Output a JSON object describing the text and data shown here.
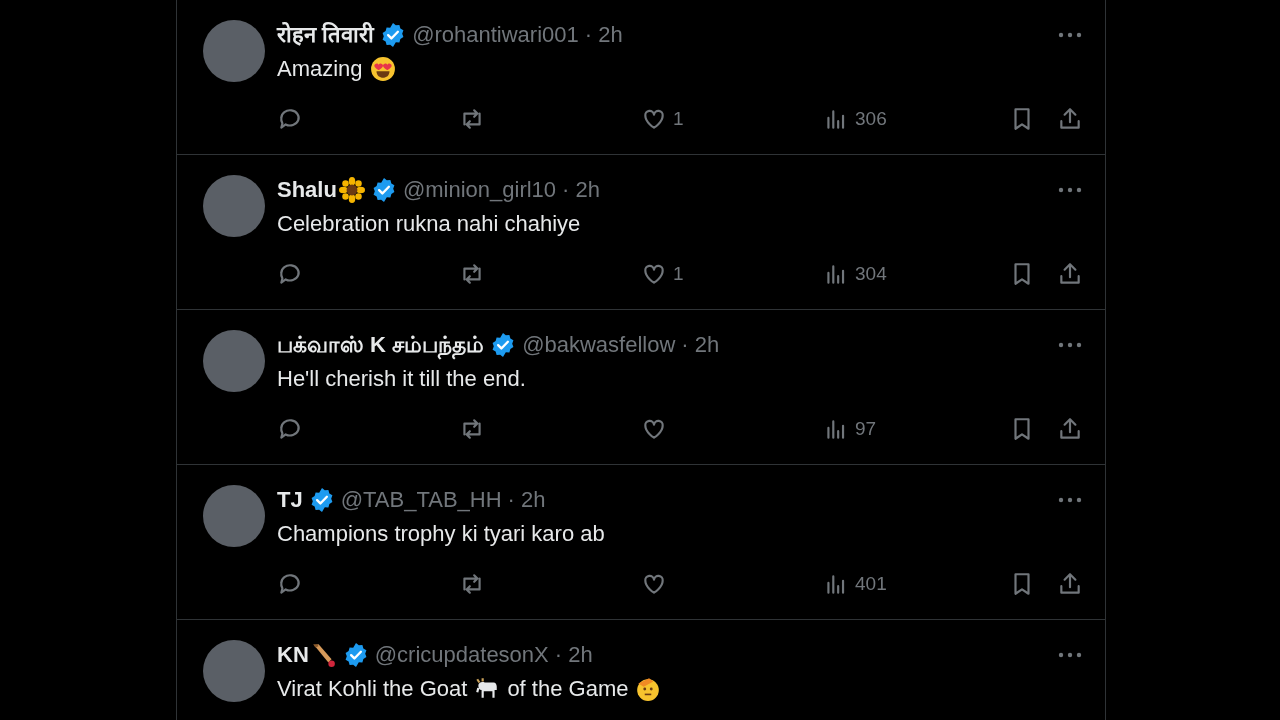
{
  "replies": [
    {
      "name": [
        {
          "kind": "text",
          "text": "रोहन तिवारी"
        }
      ],
      "verified": true,
      "handle": "@rohantiwari001",
      "time": "· 2h",
      "body": [
        {
          "kind": "text",
          "text": "Amazing"
        },
        {
          "kind": "heart-eyes"
        }
      ],
      "actions": {
        "likes": "1",
        "views": "306"
      }
    },
    {
      "name": [
        {
          "kind": "text",
          "text": "Shalu"
        },
        {
          "kind": "sunflower"
        }
      ],
      "verified": true,
      "handle": "@minion_girl10",
      "time": "· 2h",
      "body": [
        {
          "kind": "text",
          "text": "Celebration rukna nahi chahiye"
        }
      ],
      "actions": {
        "likes": "1",
        "views": "304"
      }
    },
    {
      "name": [
        {
          "kind": "text",
          "text": "பக்வாஸ் K சம்பந்தம்"
        }
      ],
      "verified": true,
      "handle": "@bakwasfellow",
      "time": "· 2h",
      "body": [
        {
          "kind": "text",
          "text": "He'll cherish it till the end."
        }
      ],
      "actions": {
        "views": "97"
      }
    },
    {
      "name": [
        {
          "kind": "text",
          "text": "TJ"
        }
      ],
      "verified": true,
      "handle": "@TAB_TAB_HH",
      "time": "· 2h",
      "body": [
        {
          "kind": "text",
          "text": "Champions trophy ki tyari karo ab"
        }
      ],
      "actions": {
        "views": "401"
      }
    },
    {
      "name": [
        {
          "kind": "text",
          "text": "KN"
        },
        {
          "kind": "bat"
        }
      ],
      "verified": true,
      "handle": "@cricupdatesonX",
      "time": "· 2h",
      "body": [
        {
          "kind": "text",
          "text": "Virat Kohli the Goat"
        },
        {
          "kind": "goat"
        },
        {
          "kind": "text",
          "text": "of the Game"
        },
        {
          "kind": "salute"
        }
      ]
    }
  ]
}
